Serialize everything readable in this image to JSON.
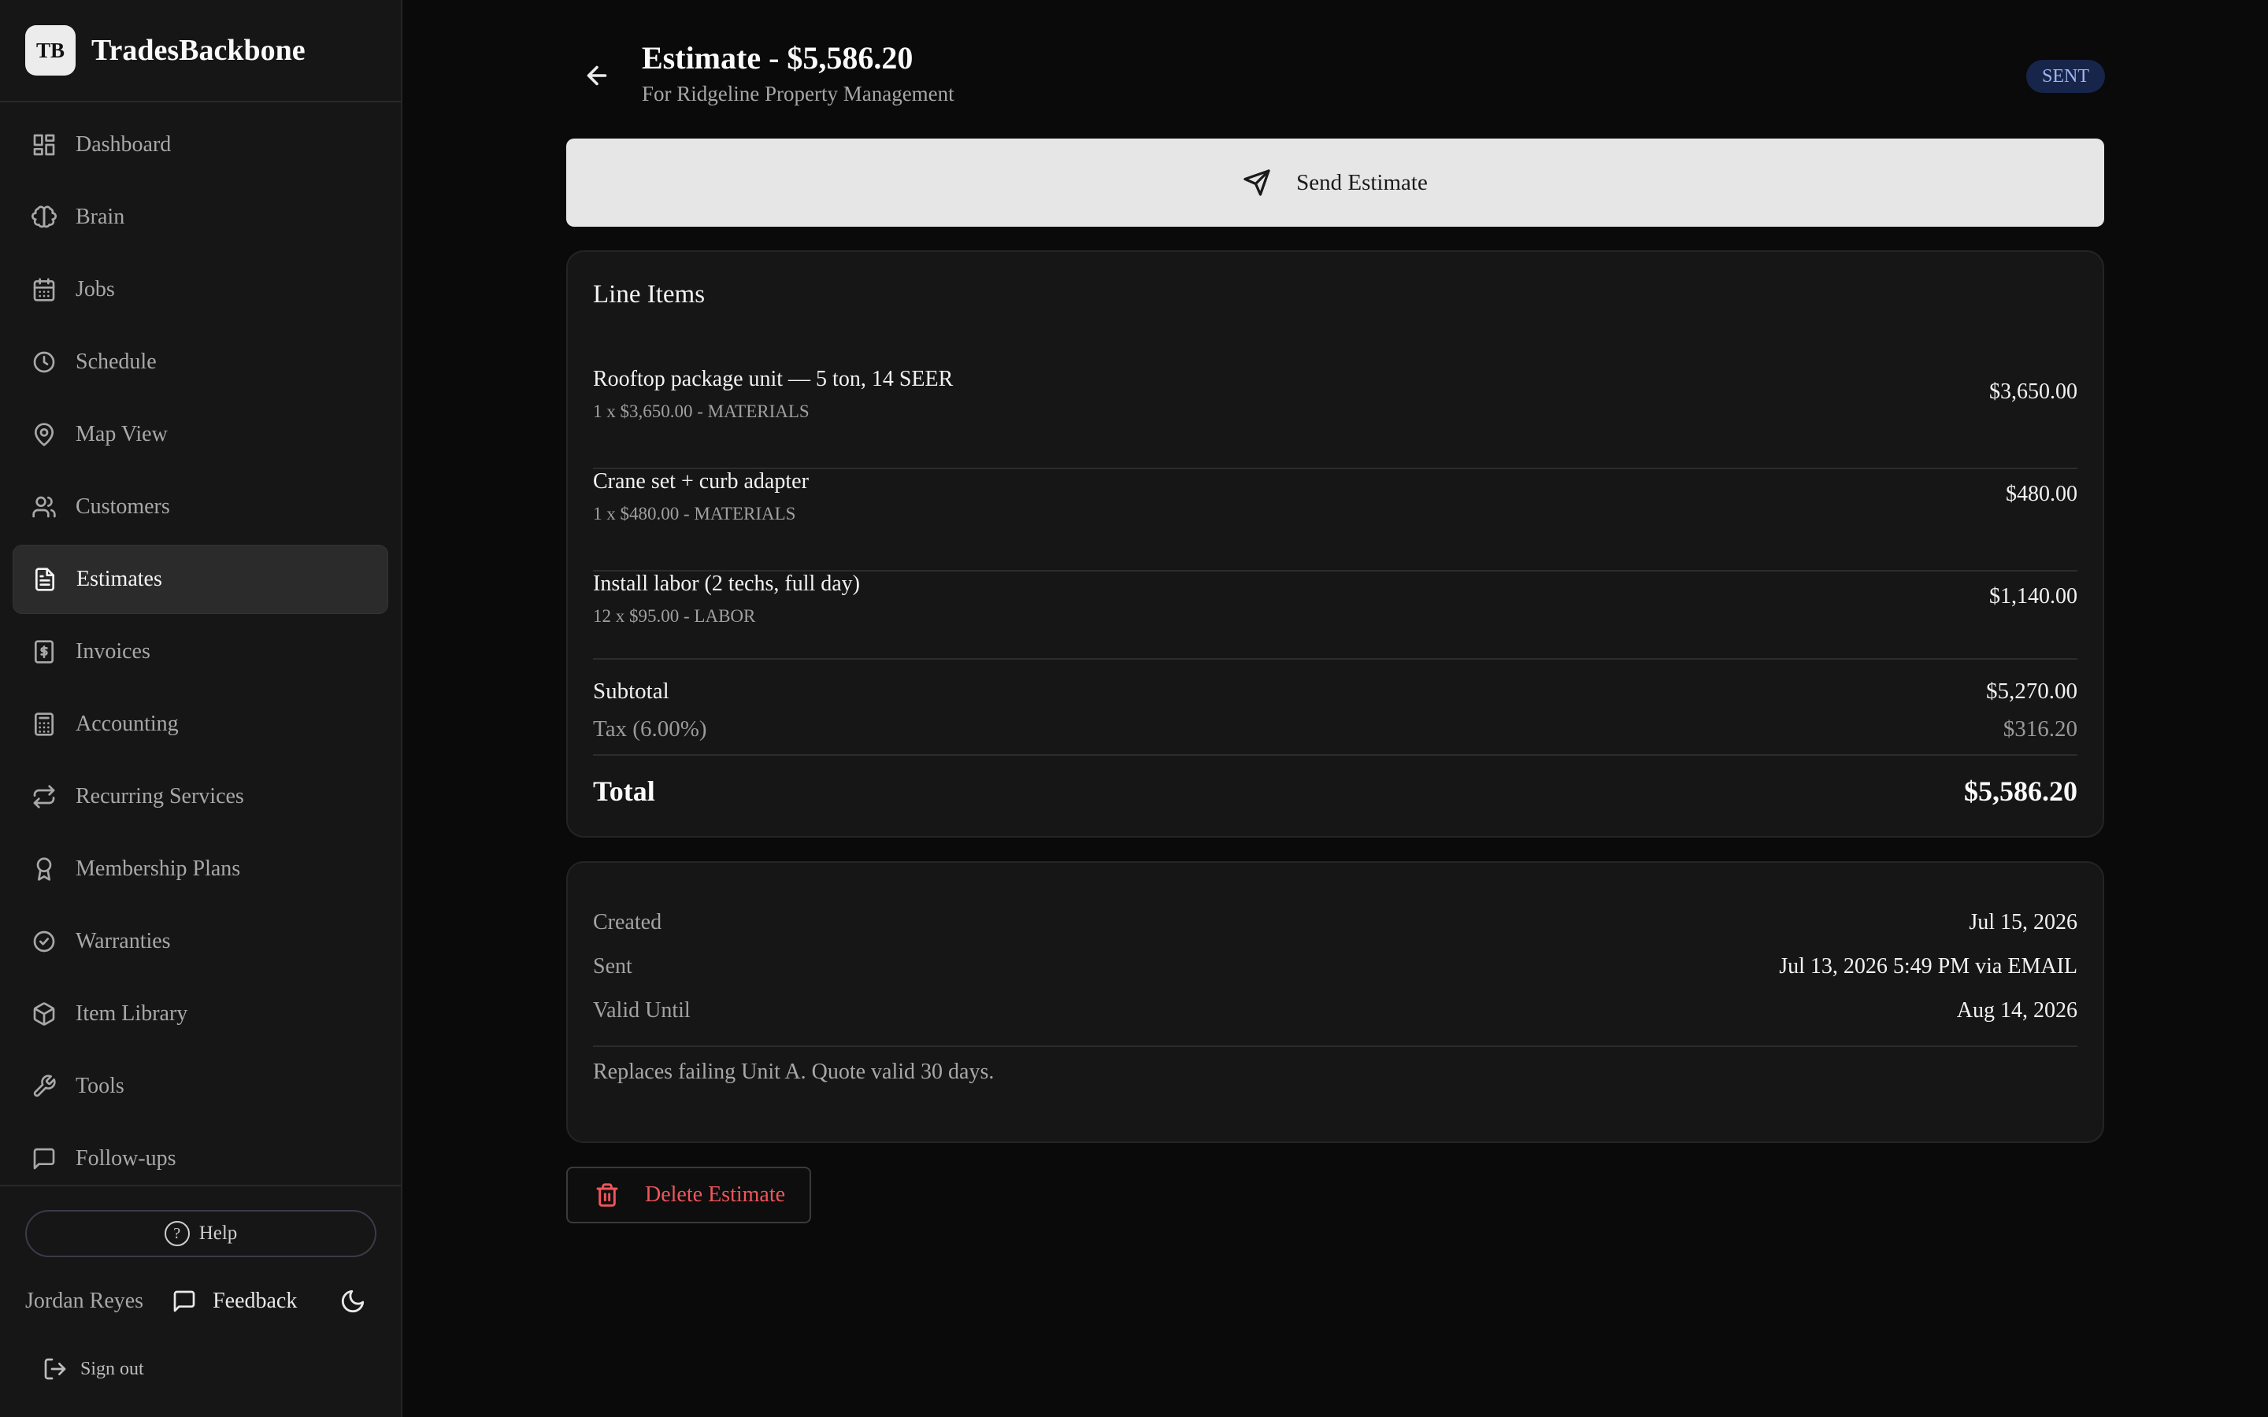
{
  "brand": {
    "logo_text": "TB",
    "name": "TradesBackbone"
  },
  "sidebar": {
    "items": [
      {
        "label": "Dashboard",
        "icon": "dashboard-icon"
      },
      {
        "label": "Brain",
        "icon": "brain-icon"
      },
      {
        "label": "Jobs",
        "icon": "calendar-icon"
      },
      {
        "label": "Schedule",
        "icon": "clock-icon"
      },
      {
        "label": "Map View",
        "icon": "map-pin-icon"
      },
      {
        "label": "Customers",
        "icon": "users-icon"
      },
      {
        "label": "Estimates",
        "icon": "document-icon",
        "active": true
      },
      {
        "label": "Invoices",
        "icon": "receipt-dollar-icon"
      },
      {
        "label": "Accounting",
        "icon": "calculator-icon"
      },
      {
        "label": "Recurring Services",
        "icon": "repeat-icon"
      },
      {
        "label": "Membership Plans",
        "icon": "award-icon"
      },
      {
        "label": "Warranties",
        "icon": "badge-check-icon"
      },
      {
        "label": "Item Library",
        "icon": "package-icon"
      },
      {
        "label": "Tools",
        "icon": "wrench-icon"
      },
      {
        "label": "Follow-ups",
        "icon": "message-square-icon"
      }
    ],
    "help_label": "Help",
    "help_glyph": "?",
    "user_name": "Jordan Reyes",
    "feedback_label": "Feedback",
    "signout_label": "Sign out"
  },
  "header": {
    "title": "Estimate - $5,586.20",
    "subtitle": "For Ridgeline Property Management",
    "status": "SENT"
  },
  "actions": {
    "send_label": "Send Estimate",
    "delete_label": "Delete Estimate"
  },
  "line_items": {
    "title": "Line Items",
    "items": [
      {
        "name": "Rooftop package unit — 5 ton, 14 SEER",
        "meta": "1 x $3,650.00 - MATERIALS",
        "amount": "$3,650.00"
      },
      {
        "name": "Crane set + curb adapter",
        "meta": "1 x $480.00 - MATERIALS",
        "amount": "$480.00"
      },
      {
        "name": "Install labor (2 techs, full day)",
        "meta": "12 x $95.00 - LABOR",
        "amount": "$1,140.00"
      }
    ],
    "subtotal_label": "Subtotal",
    "subtotal": "$5,270.00",
    "tax_label": "Tax (6.00%)",
    "tax": "$316.20",
    "total_label": "Total",
    "total": "$5,586.20"
  },
  "details": {
    "created_label": "Created",
    "created": "Jul 15, 2026",
    "sent_label": "Sent",
    "sent": "Jul 13, 2026 5:49 PM via EMAIL",
    "valid_label": "Valid Until",
    "valid": "Aug 14, 2026",
    "notes": "Replaces failing Unit A. Quote valid 30 days."
  },
  "colors": {
    "background": "#0a0a0a",
    "sidebar": "#161616",
    "card": "#161616",
    "badge_bg": "#18254a",
    "badge_text": "#9fb6f0",
    "danger": "#f0555a",
    "send_button": "#e6e6e6"
  }
}
